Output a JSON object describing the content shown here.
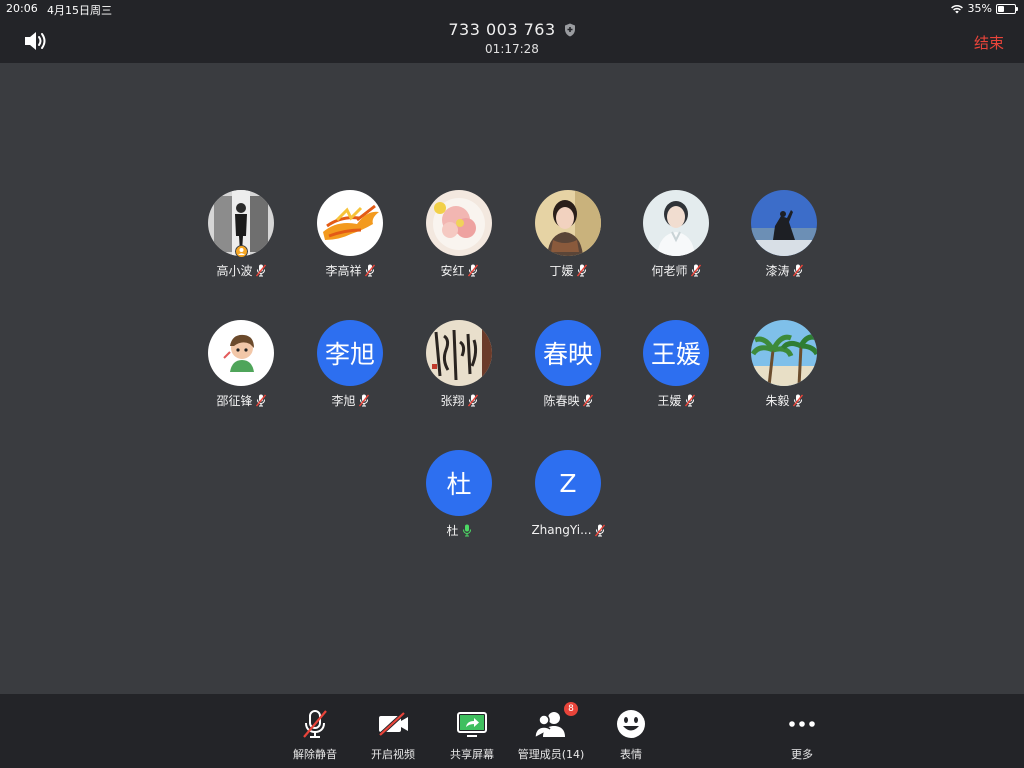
{
  "status_bar": {
    "time": "20:06",
    "date": "4月15日周三",
    "battery": "35%"
  },
  "header": {
    "meeting_id": "733 003 763",
    "timer": "01:17:28",
    "end_label": "结束"
  },
  "participants": [
    {
      "name": "高小波",
      "avatar": "photo",
      "initial": "",
      "mic": "muted",
      "host": true
    },
    {
      "name": "李高祥",
      "avatar": "photo",
      "initial": "",
      "mic": "muted",
      "host": false
    },
    {
      "name": "安红",
      "avatar": "photo",
      "initial": "",
      "mic": "muted",
      "host": false
    },
    {
      "name": "丁媛",
      "avatar": "photo",
      "initial": "",
      "mic": "muted",
      "host": false
    },
    {
      "name": "何老师",
      "avatar": "photo",
      "initial": "",
      "mic": "muted",
      "host": false
    },
    {
      "name": "漆涛",
      "avatar": "photo",
      "initial": "",
      "mic": "muted",
      "host": false
    },
    {
      "name": "邵征锋",
      "avatar": "photo",
      "initial": "",
      "mic": "muted",
      "host": false
    },
    {
      "name": "李旭",
      "avatar": "initial",
      "initial": "李旭",
      "mic": "muted",
      "host": false
    },
    {
      "name": "张翔",
      "avatar": "photo",
      "initial": "",
      "mic": "muted",
      "host": false
    },
    {
      "name": "陈春映",
      "avatar": "initial",
      "initial": "春映",
      "mic": "muted",
      "host": false
    },
    {
      "name": "王媛",
      "avatar": "initial",
      "initial": "王媛",
      "mic": "muted",
      "host": false
    },
    {
      "name": "朱毅",
      "avatar": "photo",
      "initial": "",
      "mic": "muted",
      "host": false
    },
    {
      "name": "杜",
      "avatar": "initial",
      "initial": "杜",
      "mic": "on",
      "host": false
    },
    {
      "name": "ZhangYi...",
      "avatar": "initial",
      "initial": "Z",
      "mic": "muted",
      "host": false
    }
  ],
  "toolbar": {
    "unmute": "解除静音",
    "start_video": "开启视频",
    "share_screen": "共享屏幕",
    "manage_members": "管理成员(14)",
    "members_badge": "8",
    "reactions": "表情",
    "more": "更多"
  },
  "colors": {
    "background": "#3a3c40",
    "bar": "#232428",
    "accent_blue": "#2d6ff0",
    "end_red": "#e8443a",
    "mic_green": "#4cd964",
    "muted_red": "#e8443a"
  }
}
